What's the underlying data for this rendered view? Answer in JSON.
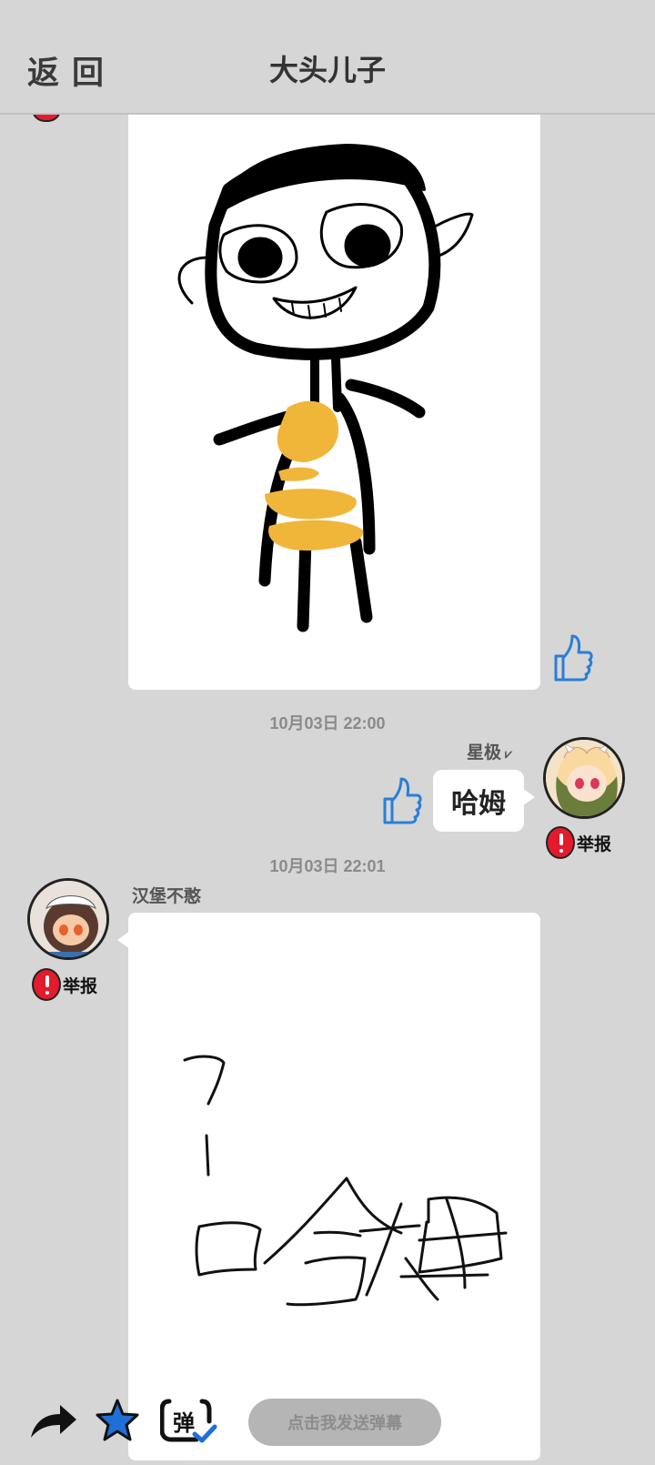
{
  "header": {
    "back_label": "返回",
    "title": "大头儿子"
  },
  "messages": [
    {
      "type": "drawing",
      "subject": "stick-figure",
      "liked": false
    },
    {
      "time": "10月03日  22:00",
      "user": "星极",
      "text": "哈姆",
      "report_label": "举报",
      "side": "right"
    },
    {
      "time": "10月03日  22:01",
      "user": "汉堡不憨",
      "report_label": "举报",
      "side": "left",
      "drawing_text": "?  哈姆"
    }
  ],
  "toolbar": {
    "icons": [
      "share-icon",
      "star-icon",
      "danmaku-icon"
    ],
    "danmaku_placeholder": "点击我发送弹幕"
  },
  "colors": {
    "background": "#d6d6d6",
    "like_blue": "#2a7fd6",
    "report_red": "#e21b2d",
    "star_blue": "#1f6fd9"
  }
}
